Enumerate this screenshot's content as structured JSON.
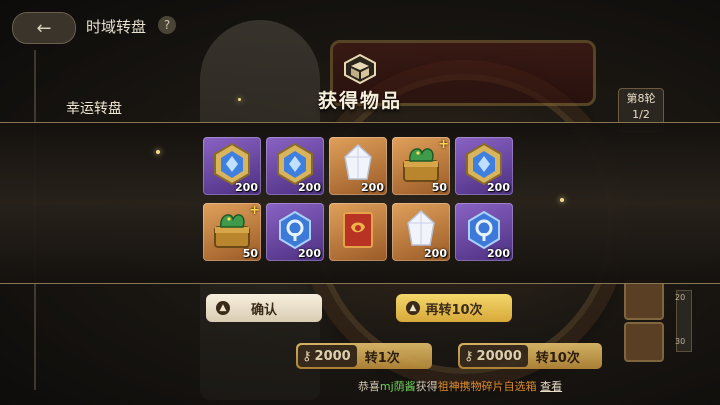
{
  "header": {
    "back_icon": "back-arrow-icon",
    "title": "时域转盘",
    "help_label": "?"
  },
  "sidebar": {
    "lucky_wheel_label": "幸运转盘"
  },
  "round_info": {
    "label": "第8轮",
    "progress": "1/2"
  },
  "side_scale": {
    "marks": [
      "20",
      "30"
    ]
  },
  "modal": {
    "title": "获得物品",
    "items": [
      {
        "icon": "blue-gem-badge-icon",
        "rarity": "purple",
        "count": "200",
        "plus": false
      },
      {
        "icon": "blue-gem-badge-icon",
        "rarity": "purple",
        "count": "200",
        "plus": false
      },
      {
        "icon": "white-crystal-icon",
        "rarity": "orange",
        "count": "200",
        "plus": false
      },
      {
        "icon": "dragon-chest-icon",
        "rarity": "orange",
        "count": "50",
        "plus": true
      },
      {
        "icon": "blue-gem-badge-icon",
        "rarity": "purple",
        "count": "200",
        "plus": false
      },
      {
        "icon": "dragon-chest-icon",
        "rarity": "orange",
        "count": "50",
        "plus": true
      },
      {
        "icon": "blue-orb-icon",
        "rarity": "purple",
        "count": "200",
        "plus": false
      },
      {
        "icon": "red-scroll-icon",
        "rarity": "orange",
        "count": "",
        "plus": false
      },
      {
        "icon": "white-crystal-icon",
        "rarity": "orange",
        "count": "200",
        "plus": false
      },
      {
        "icon": "blue-orb-icon",
        "rarity": "purple",
        "count": "200",
        "plus": false
      }
    ],
    "confirm_label": "确认",
    "spin_again_label": "再转10次"
  },
  "spin_buttons": {
    "single": {
      "cost": "2000",
      "label": "转1次"
    },
    "ten": {
      "cost": "20000",
      "label": "转10次"
    }
  },
  "notice": {
    "prefix": "恭喜",
    "user": "mj荫酱",
    "middle": "获得",
    "prize": "祖神携物碎片自选箱",
    "link": "查看"
  },
  "colors": {
    "purple_rarity": "#6a45a8",
    "orange_rarity": "#c47a3a",
    "confirm_button": "#eee3cc",
    "spin_again_button": "#e8bf50",
    "notice_user": "#6fcf5b",
    "notice_prize": "#d98a2e"
  }
}
